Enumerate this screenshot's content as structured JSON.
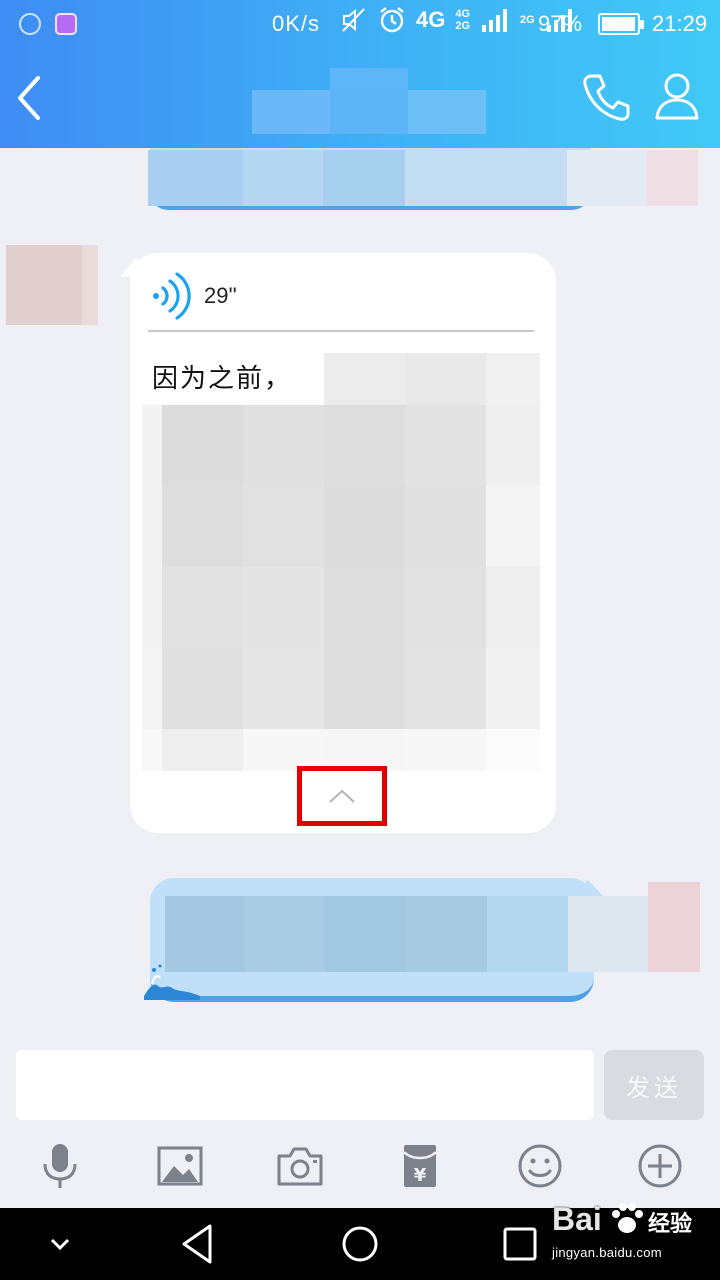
{
  "status_bar": {
    "net_speed": "0K/s",
    "network_main": "4G",
    "network_small_top": "4G",
    "network_small_bottom": "2G",
    "network_second": "2G",
    "battery_percent": "97%",
    "battery_level": 0.97,
    "time": "21:29"
  },
  "header": {
    "back_icon": "chevron-left-icon",
    "call_icon": "phone-icon",
    "profile_icon": "person-icon"
  },
  "messages": {
    "voice": {
      "duration": "29''",
      "transcript_start": "因为之前，",
      "collapse_icon": "chevron-up-icon",
      "highlight_color": "#e00000"
    }
  },
  "composer": {
    "input_value": "",
    "input_placeholder": "",
    "send_label": "发送"
  },
  "toolbar": {
    "items": [
      "microphone-icon",
      "image-icon",
      "camera-icon",
      "red-packet-icon",
      "emoji-icon",
      "plus-icon"
    ]
  },
  "navbar": {
    "items": [
      "hide-keyboard-icon",
      "back-icon",
      "home-icon",
      "recents-icon"
    ]
  },
  "watermark": {
    "logo_text": "Bai",
    "cn_text": "经验",
    "url": "jingyan.baidu.com"
  },
  "colors": {
    "header_gradient_start": "#3f8cf4",
    "header_gradient_end": "#40c9f6",
    "chat_background": "#eef0f6",
    "sent_bubble": "#bfe0f8"
  }
}
